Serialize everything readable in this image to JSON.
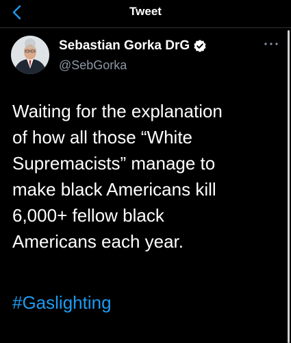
{
  "header": {
    "title": "Tweet",
    "back_icon": "chevron-left-icon"
  },
  "author": {
    "display_name": "Sebastian Gorka DrG",
    "handle": "@SebGorka",
    "verified_icon": "verified-badge-icon"
  },
  "more_icon": "ellipsis-icon",
  "tweet": {
    "text": "Waiting for the explanation\nof how all those “White\nSupremacists” manage to\nmake black Americans kill\n6,000+ fellow black\nAmericans each year.",
    "hashtag": "#Gaslighting"
  },
  "colors": {
    "background": "#000000",
    "text": "#ffffff",
    "secondary_text": "#8b98a5",
    "accent": "#1d9bf0",
    "divider": "#2f3336"
  }
}
